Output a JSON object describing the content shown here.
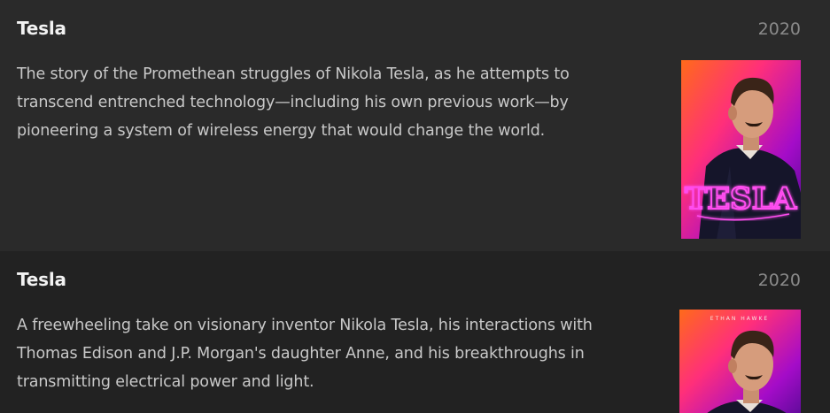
{
  "results": [
    {
      "title": "Tesla",
      "year": "2020",
      "overview": "The story of the Promethean struggles of Nikola Tesla, as he attempts to transcend entrenched technology—including his own previous work—by pioneering a system of wireless energy that would change the world.",
      "poster": {
        "logo_text": "TESLA"
      }
    },
    {
      "title": "Tesla",
      "year": "2020",
      "overview": "A freewheeling take on visionary inventor Nikola Tesla, his interactions with Thomas Edison and J.P. Morgan's daughter Anne, and his breakthroughs in transmitting electrical power and light.",
      "poster": {
        "credit_text": "ETHAN HAWKE"
      }
    }
  ],
  "colors": {
    "background": "#252525",
    "row_alt": "#2a2a2a",
    "title": "#f2f2f2",
    "year": "#8a8a8a",
    "text": "#c8c8c8",
    "neon": "#ff4df0"
  }
}
